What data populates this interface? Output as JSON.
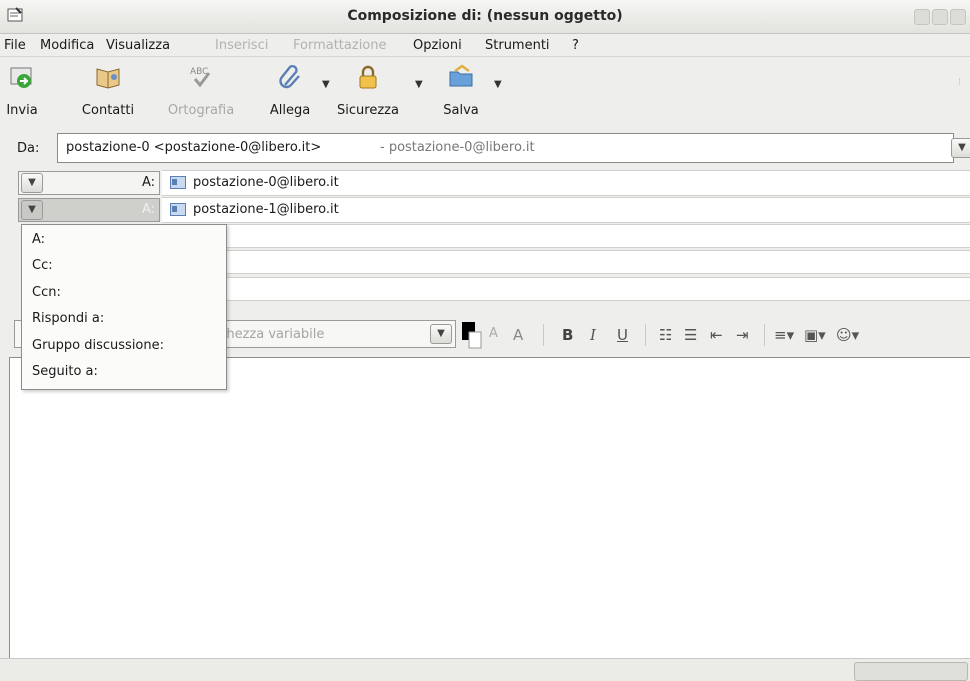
{
  "window": {
    "title": "Composizione di: (nessun oggetto)"
  },
  "menu": [
    "File",
    "Modifica",
    "Visualizza",
    "Inserisci",
    "Formattazione",
    "Opzioni",
    "Strumenti",
    "?"
  ],
  "toolbar": {
    "send": "Invia",
    "contacts": "Contatti",
    "spell": "Ortografia",
    "spell_icon_text": "ABC",
    "attach": "Allega",
    "security": "Sicurezza",
    "save": "Salva"
  },
  "from": {
    "label": "Da:",
    "address": "postazione-0 <postazione-0@libero.it>",
    "account": "- postazione-0@libero.it"
  },
  "recipients": [
    {
      "type": "A:",
      "address": "postazione-0@libero.it"
    },
    {
      "type": "A:",
      "address": "postazione-1@libero.it"
    }
  ],
  "recipient_type_menu": [
    "A:",
    "Cc:",
    "Ccn:",
    "Rispondi a:",
    "Gruppo discussione:",
    "Seguito a:"
  ],
  "format": {
    "font_placeholder": "rghezza variabile",
    "bold": "B",
    "italic": "I",
    "underline": "U"
  }
}
